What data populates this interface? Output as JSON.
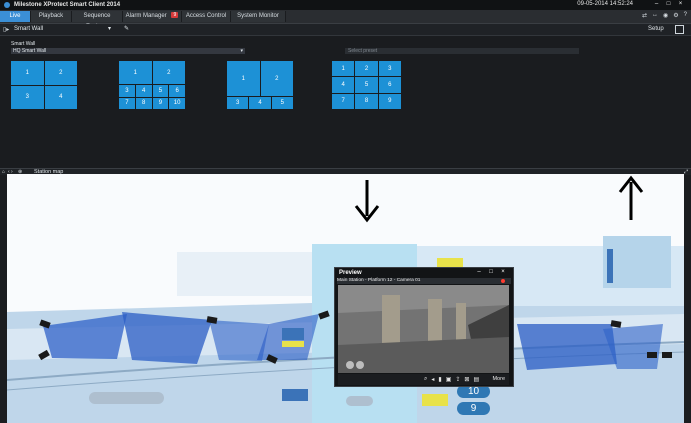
{
  "app": {
    "title": "Milestone XProtect Smart Client 2014",
    "datetime": "09-05-2014 14:52:24",
    "window_buttons": [
      "–",
      "□",
      "×"
    ]
  },
  "tabs": [
    {
      "label": "Live",
      "active": true
    },
    {
      "label": "Playback",
      "active": false
    },
    {
      "label": "Sequence Explorer",
      "active": false
    },
    {
      "label": "Alarm Manager",
      "active": false,
      "badge": "9"
    },
    {
      "label": "Access Control",
      "active": false
    },
    {
      "label": "System Monitor",
      "active": false
    }
  ],
  "tab_icons": [
    "share-icon",
    "arrows-icon",
    "globe-icon",
    "gear-icon",
    "help-icon"
  ],
  "toolbar": {
    "view_label": "Smart Wall",
    "dropdown_glyph": "▾",
    "setup_label": "Setup"
  },
  "smart_wall": {
    "section_label": "Smart Wall",
    "selected": "HQ Smart Wall",
    "preset_placeholder": "Select preset",
    "layouts": [
      {
        "name": "layout-1",
        "cells": [
          "1",
          "2",
          "3",
          "4"
        ]
      },
      {
        "name": "layout-2",
        "cells": [
          "1",
          "2",
          "3",
          "4",
          "5",
          "6",
          "7",
          "8",
          "9",
          "10"
        ]
      },
      {
        "name": "layout-3",
        "cells": [
          "1",
          "2",
          "3",
          "4",
          "5"
        ]
      },
      {
        "name": "layout-4",
        "cells": [
          "1",
          "2",
          "3",
          "4",
          "5",
          "6",
          "7",
          "8",
          "9"
        ]
      }
    ]
  },
  "map_header": {
    "label": "Station map"
  },
  "preview": {
    "title": "Preview",
    "caption": "Main Station - Platform 12 - Camera 01",
    "more_label": "More"
  },
  "map_numbers": [
    "10",
    "9"
  ],
  "colors": {
    "accent": "#1d91d6",
    "map_blue": "#4f86d9",
    "bg_dark": "#1a1c1f"
  }
}
